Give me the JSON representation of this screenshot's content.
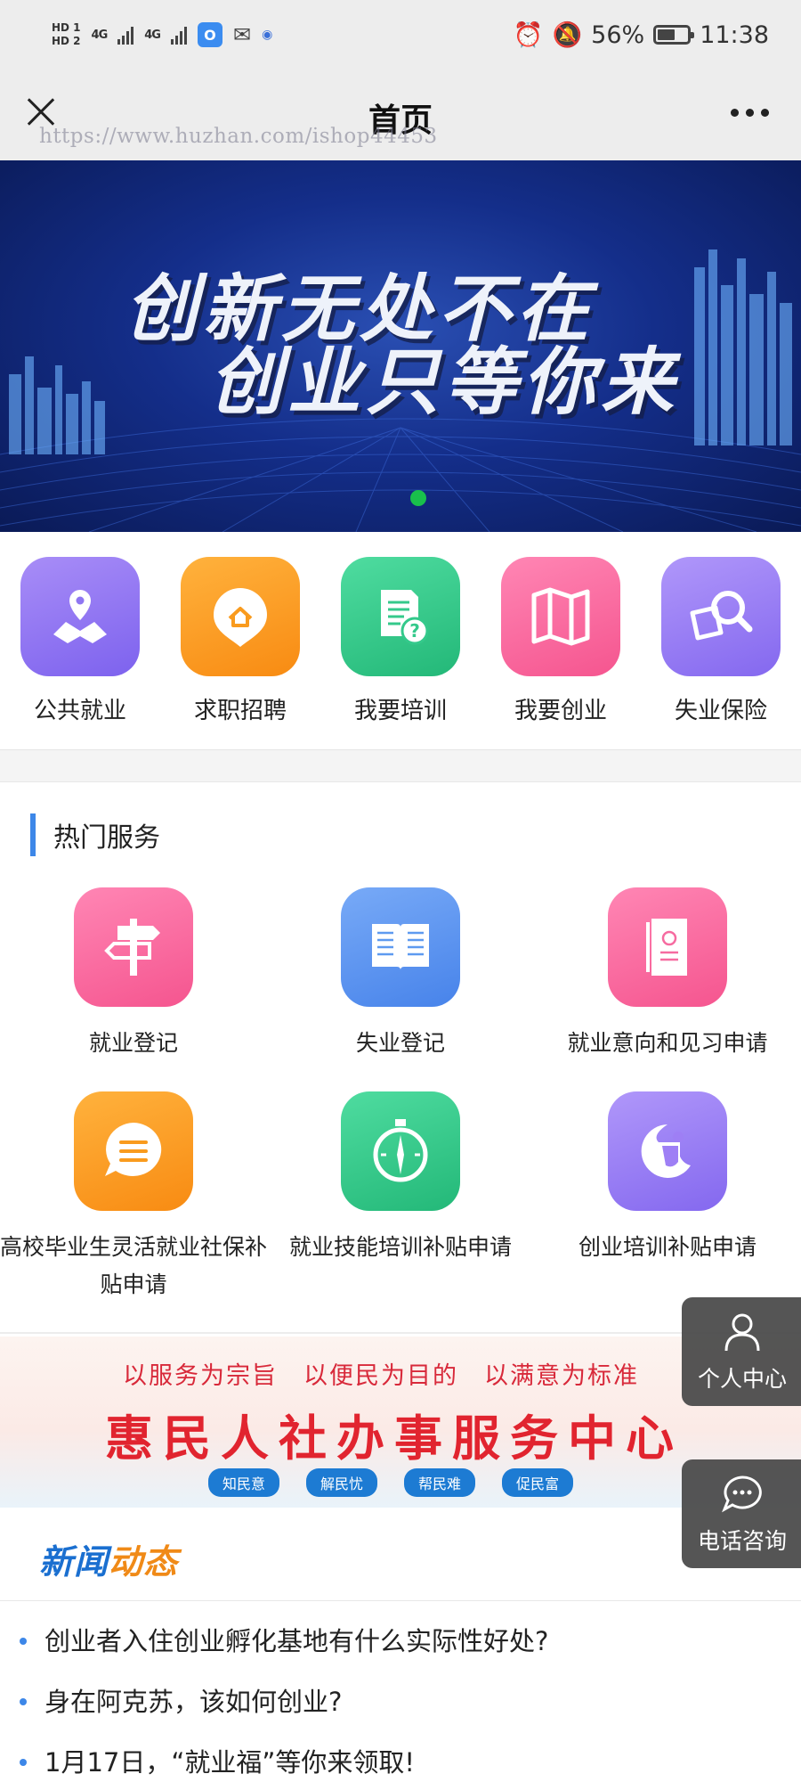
{
  "status_bar": {
    "network_hd1": "HD 1",
    "network_hd2": "HD 2",
    "signal1": "4G",
    "signal2": "4G",
    "app_icon": "O",
    "battery": "56%",
    "time": "11:38"
  },
  "title_bar": {
    "title": "首页",
    "watermark": "https://www.huzhan.com/ishop44453"
  },
  "banner": {
    "line1": "创新无处不在",
    "line2": "创业只等你来",
    "active_slide": 1
  },
  "quick_nav": [
    {
      "label": "公共就业",
      "icon": "map-pin-icon",
      "color": "#8f76f2"
    },
    {
      "label": "求职招聘",
      "icon": "home-bubble-icon",
      "color": "#f99b1e"
    },
    {
      "label": "我要培训",
      "icon": "document-question-icon",
      "color": "#34c98b"
    },
    {
      "label": "我要创业",
      "icon": "folded-map-icon",
      "color": "#f86aa2"
    },
    {
      "label": "失业保险",
      "icon": "magnifier-icon",
      "color": "#9e7ff5"
    }
  ],
  "hot_services": {
    "title": "热门服务",
    "items": [
      {
        "label": "就业登记",
        "icon": "signpost-icon",
        "color": "#f66ba0"
      },
      {
        "label": "失业登记",
        "icon": "open-book-icon",
        "color": "#5e9af0"
      },
      {
        "label": "就业意向和见习申请",
        "icon": "id-card-icon",
        "color": "#f66ba0"
      },
      {
        "label": "高校毕业生灵活就业社保补贴申请",
        "icon": "chat-bubble-icon",
        "color": "#f99b1e"
      },
      {
        "label": "就业技能培训补贴申请",
        "icon": "stopwatch-icon",
        "color": "#34c98b"
      },
      {
        "label": "创业培训补贴申请",
        "icon": "person-logo-icon",
        "color": "#9e7ff5"
      }
    ]
  },
  "ad_banner": {
    "slogan": "以服务为宗旨　以便民为目的　以满意为标准",
    "title": "惠民人社办事服务中心",
    "tags": [
      "知民意",
      "解民忧",
      "帮民难",
      "促民富"
    ]
  },
  "news": {
    "logo_part1": "新闻",
    "logo_part2": "动态",
    "items": [
      "创业者入住创业孵化基地有什么实际性好处?",
      "身在阿克苏，该如何创业?",
      "1月17日，“就业福”等你来领取!"
    ]
  },
  "floating": {
    "personal_center": "个人中心",
    "phone_consult": "电话咨询"
  }
}
